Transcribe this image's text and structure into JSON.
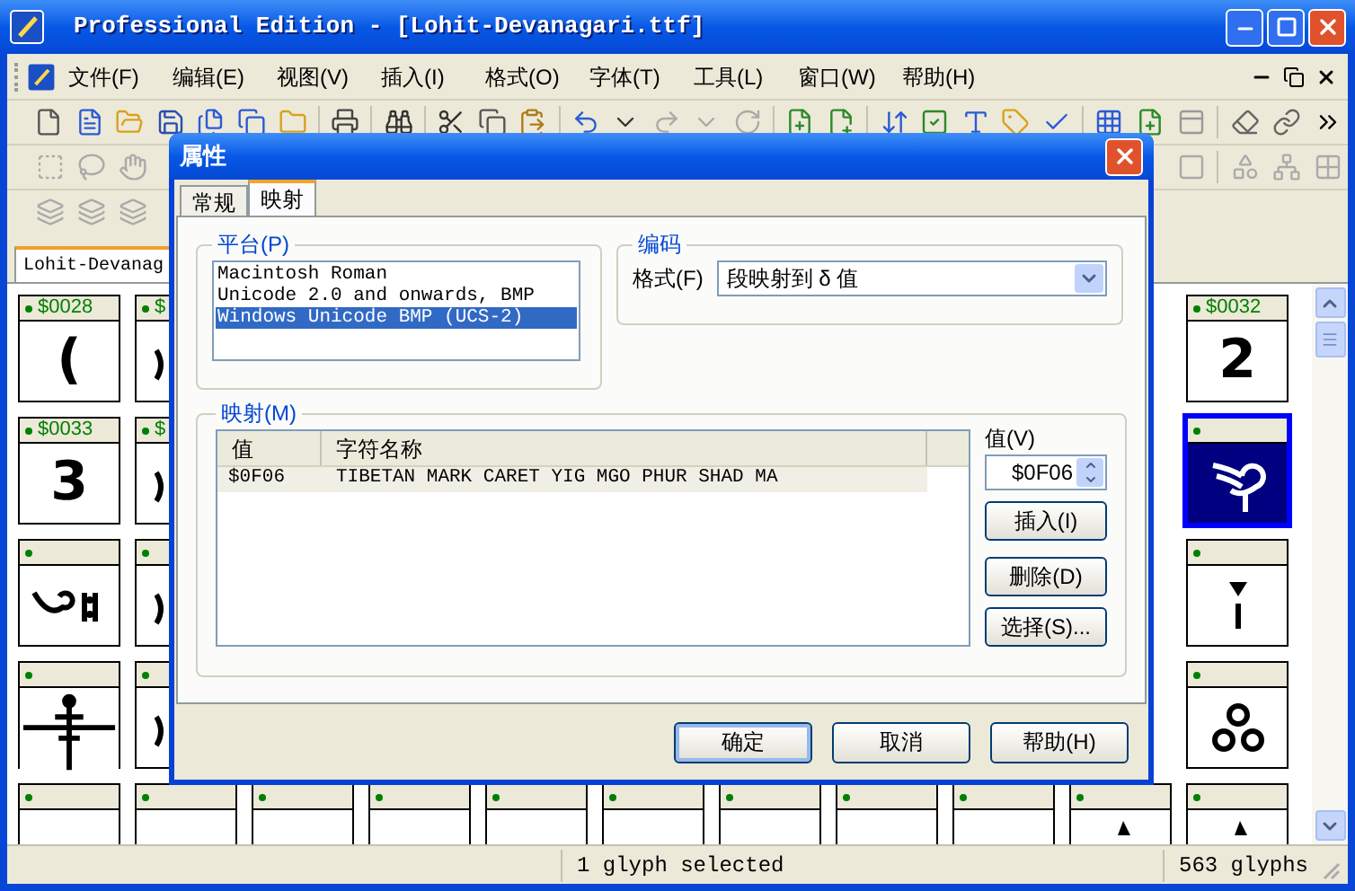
{
  "window": {
    "title": "Professional Edition - [Lohit-Devanagari.ttf]"
  },
  "menu": [
    "文件(F)",
    "编辑(E)",
    "视图(V)",
    "插入(I)",
    "格式(O)",
    "字体(T)",
    "工具(L)",
    "窗口(W)",
    "帮助(H)"
  ],
  "font_tab": {
    "label": "Lohit-Devanag",
    "selected": true
  },
  "glyph_grid": {
    "rows": [
      {
        "cells": [
          {
            "label": "$0028",
            "kind": "char",
            "glyph": "(",
            "selected": false
          },
          {
            "label": "$",
            "kind": "edge",
            "selected": false
          },
          {
            "label": "$0032",
            "kind": "char",
            "glyph": "2",
            "selected": false
          }
        ]
      },
      {
        "cells": [
          {
            "label": "$0033",
            "kind": "char",
            "glyph": "3",
            "selected": false
          },
          {
            "label": "$",
            "kind": "edge",
            "selected": false
          },
          {
            "kind": "swirl",
            "selected": true
          }
        ]
      },
      {
        "cells": [
          {
            "kind": "hook",
            "selected": false
          },
          {
            "kind": "edge",
            "selected": false
          },
          {
            "kind": "dagger",
            "selected": false
          }
        ]
      },
      {
        "cells": [
          {
            "kind": "figure",
            "selected": false
          },
          {
            "kind": "edge",
            "selected": false
          },
          {
            "kind": "rings",
            "selected": false
          }
        ]
      },
      {
        "cells": [
          {
            "kind": "empty",
            "selected": false
          },
          {
            "kind": "empty",
            "selected": false
          },
          {
            "kind": "empty",
            "selected": false
          },
          {
            "kind": "empty",
            "selected": false
          },
          {
            "kind": "empty",
            "selected": false
          },
          {
            "kind": "empty",
            "selected": false
          },
          {
            "kind": "empty",
            "selected": false
          },
          {
            "kind": "empty",
            "selected": false
          },
          {
            "kind": "empty",
            "selected": false
          },
          {
            "kind": "tip",
            "selected": false
          },
          {
            "kind": "tip",
            "selected": false
          }
        ]
      }
    ]
  },
  "status_bar": {
    "selection": "1 glyph selected",
    "count": "563 glyphs"
  },
  "dialog": {
    "title": "属性",
    "tabs": [
      {
        "label": "常规",
        "selected": false
      },
      {
        "label": "映射",
        "selected": true
      }
    ],
    "platform": {
      "legend": "平台(P)",
      "items": [
        {
          "label": "Macintosh Roman",
          "selected": false
        },
        {
          "label": "Unicode 2.0 and onwards, BMP",
          "selected": false
        },
        {
          "label": "Windows Unicode BMP (UCS-2)",
          "selected": true
        }
      ]
    },
    "encoding": {
      "legend": "编码",
      "format_label": "格式(F)",
      "format_value": "段映射到 δ 值"
    },
    "mapping": {
      "legend": "映射(M)",
      "columns": [
        "值",
        "字符名称"
      ],
      "rows": [
        {
          "cells": [
            "$0F06",
            "TIBETAN MARK CARET YIG MGO PHUR SHAD MA"
          ],
          "selected": true
        }
      ],
      "value_label": "值(V)",
      "value": "$0F06",
      "buttons": [
        "插入(I)",
        "删除(D)",
        "选择(S)..."
      ]
    },
    "buttons": [
      {
        "label": "确定",
        "default": true
      },
      {
        "label": "取消",
        "default": false
      },
      {
        "label": "帮助(H)",
        "default": false
      }
    ]
  }
}
